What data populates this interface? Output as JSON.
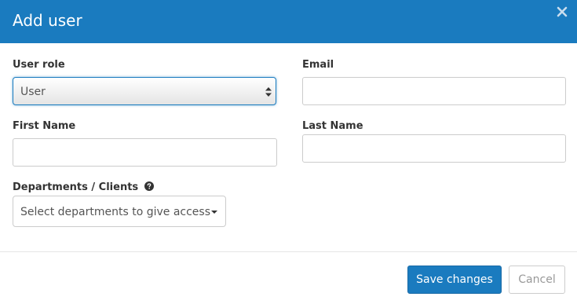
{
  "modal": {
    "title": "Add user",
    "close_icon": "close-icon"
  },
  "form": {
    "user_role": {
      "label": "User role",
      "selected": "User"
    },
    "email": {
      "label": "Email",
      "value": ""
    },
    "first_name": {
      "label": "First Name",
      "value": ""
    },
    "last_name": {
      "label": "Last Name",
      "value": ""
    },
    "departments": {
      "label": "Departments / Clients",
      "help_icon": "question-circle-icon",
      "placeholder": "Select departments to give access"
    }
  },
  "footer": {
    "save_label": "Save changes",
    "cancel_label": "Cancel"
  },
  "colors": {
    "header": "#1a7bbf",
    "primary_button": "#1a7bbf"
  }
}
